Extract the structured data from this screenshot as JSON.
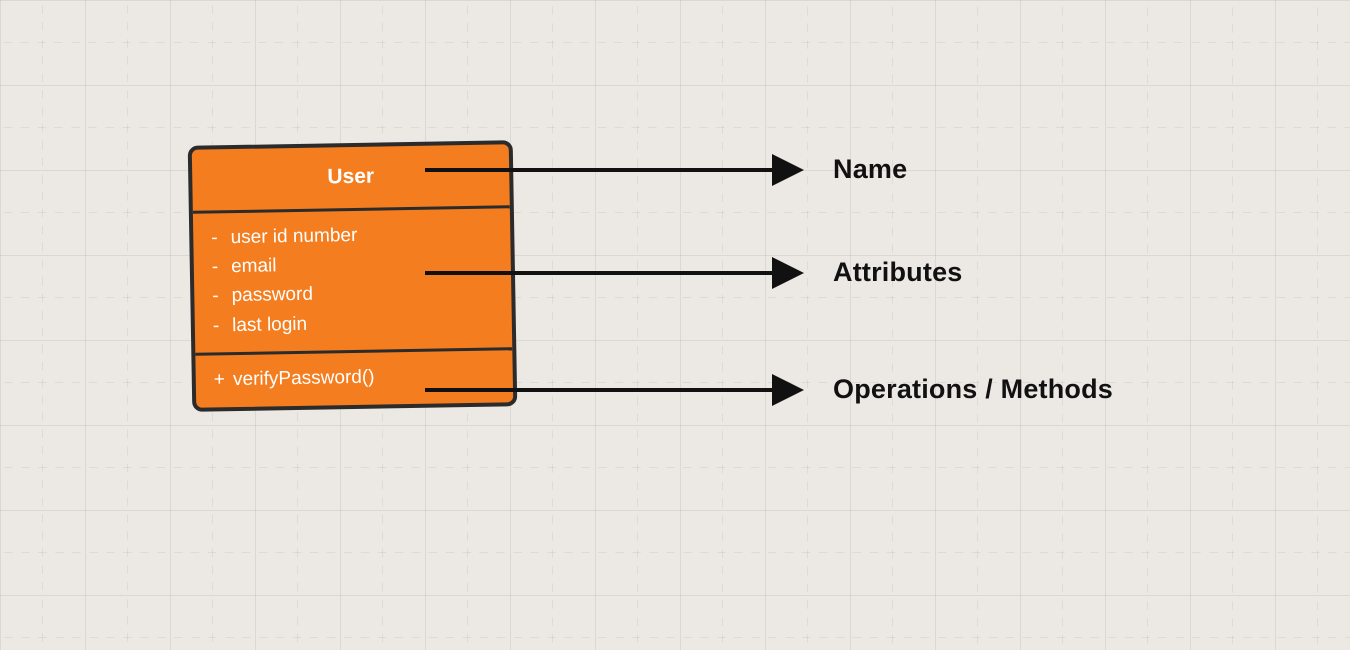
{
  "uml_class": {
    "name": "User",
    "attributes": [
      {
        "visibility": "-",
        "name": "user id number"
      },
      {
        "visibility": "-",
        "name": "email"
      },
      {
        "visibility": "-",
        "name": "password"
      },
      {
        "visibility": "-",
        "name": "last login"
      }
    ],
    "operations": [
      {
        "visibility": "+",
        "signature": "verifyPassword()"
      }
    ]
  },
  "annotations": {
    "name": "Name",
    "attributes": "Attributes",
    "operations": "Operations / Methods"
  },
  "colors": {
    "class_fill": "#f47d20",
    "class_border": "#2b2b2b",
    "text_light": "#ffffff",
    "text_dark": "#111111",
    "canvas_bg": "#ece8e4"
  }
}
